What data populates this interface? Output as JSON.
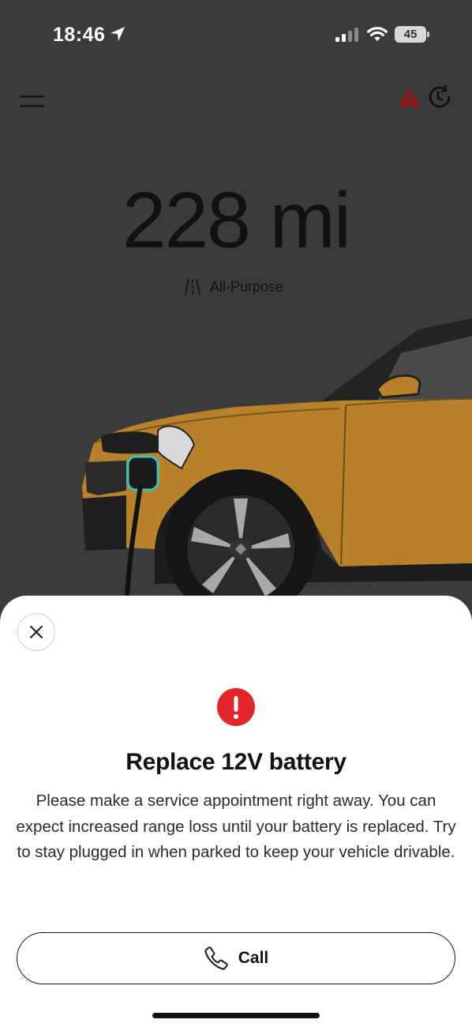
{
  "status_bar": {
    "time": "18:46",
    "battery_level": "45",
    "icons": [
      "location-arrow-icon",
      "cellular-signal-icon",
      "wifi-icon",
      "battery-icon"
    ]
  },
  "header": {
    "icons": [
      "menu-icon",
      "warning-triangle-icon",
      "history-clock-icon"
    ],
    "alert_color": "#8b1a1a"
  },
  "range": {
    "value": "228 mi",
    "drive_mode": "All-Purpose",
    "drive_mode_icon": "road-icon"
  },
  "vehicle": {
    "body_color": "#b8822a",
    "charging_port_color": "#35c6c4"
  },
  "alert_sheet": {
    "title": "Replace 12V battery",
    "body": "Please make a service appointment right away. You can expect increased range loss until your battery is replaced. Try to stay plugged in when parked to keep your vehicle drivable.",
    "call_label": "Call",
    "error_color": "#e3262a",
    "icons": [
      "close-icon",
      "error-exclamation-icon",
      "phone-icon"
    ]
  }
}
